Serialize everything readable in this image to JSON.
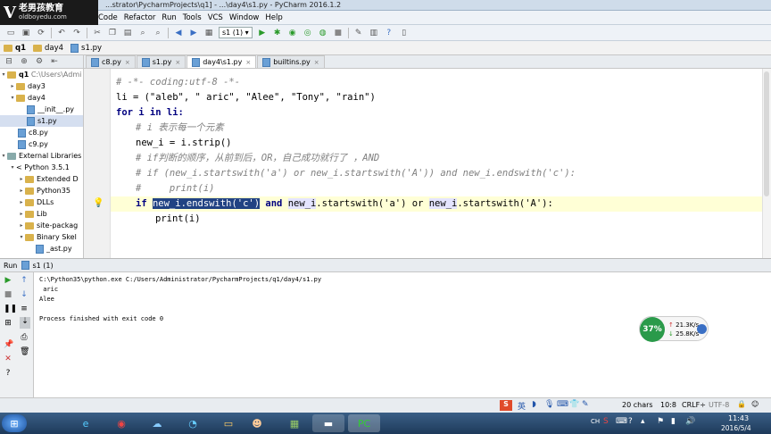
{
  "app": {
    "title": "...strator\\PycharmProjects\\q1] - ...\\day4\\s1.py - PyCharm 2016.1.2",
    "logo_line1": "老男孩教育",
    "logo_line2": "oldboyedu.com"
  },
  "menu": [
    "Code",
    "Refactor",
    "Run",
    "Tools",
    "VCS",
    "Window",
    "Help"
  ],
  "toolbar": {
    "run_config": "s1 (1)"
  },
  "breadcrumb": [
    "q1",
    "day4",
    "s1.py"
  ],
  "tabs": [
    {
      "label": "c8.py"
    },
    {
      "label": "s1.py"
    },
    {
      "label": "day4\\s1.py",
      "active": true
    },
    {
      "label": "builtins.py"
    }
  ],
  "project": {
    "header": "",
    "root": "q1",
    "root_path": "C:\\Users\\Admi",
    "items": [
      {
        "label": "day3",
        "type": "folder",
        "depth": 1
      },
      {
        "label": "day4",
        "type": "folder",
        "depth": 1
      },
      {
        "label": "__init__.py",
        "type": "py",
        "depth": 2
      },
      {
        "label": "s1.py",
        "type": "py",
        "depth": 2,
        "selected": true
      },
      {
        "label": "c8.py",
        "type": "py",
        "depth": 1
      },
      {
        "label": "c9.py",
        "type": "py",
        "depth": 1
      },
      {
        "label": "External Libraries",
        "type": "lib",
        "depth": 0
      },
      {
        "label": "< Python 3.5.1",
        "type": "lib",
        "depth": 1
      },
      {
        "label": "Extended D",
        "type": "folder",
        "depth": 2
      },
      {
        "label": "Python35",
        "type": "folder",
        "depth": 2
      },
      {
        "label": "DLLs",
        "type": "folder",
        "depth": 2
      },
      {
        "label": "Lib",
        "type": "folder",
        "depth": 2
      },
      {
        "label": "site-packag",
        "type": "folder",
        "depth": 2
      },
      {
        "label": "Binary Skel",
        "type": "folder",
        "depth": 2
      },
      {
        "label": "_ast.py",
        "type": "py",
        "depth": 3
      }
    ]
  },
  "code": {
    "line1": "# -*- coding:utf-8 -*-",
    "line2": "li = (\"aleb\", \" aric\", \"Alee\", \"Tony\", \"rain\")",
    "line3": "for i in li:",
    "line4": "# i 表示每一个元素",
    "line5": "new_i = i.strip()",
    "line6": "# if判断的顺序，从前到后，OR，自己成功就行了 ，AND",
    "line7": "# if (new_i.startswith('a') or new_i.startswith('A')) and new_i.endswith('c'):",
    "line8": "#     print(i)",
    "line9a": "if ",
    "line9sel": "new_i.endswith('c')",
    "line9b": " and ",
    "line9c": "new_i",
    "line9d": ".startswith('a') or ",
    "line9e": "new_i",
    "line9f": ".startswith('A'):",
    "line10": "print(i)"
  },
  "run": {
    "tab_label": "Run",
    "config": "s1 (1)",
    "output": [
      "C:\\Python35\\python.exe C:/Users/Administrator/PycharmProjects/q1/day4/s1.py",
      " aric",
      "Alee",
      "",
      "Process finished with exit code 0"
    ]
  },
  "net": {
    "percent": "37%",
    "up": "21.3K/s",
    "down": "25.8K/s"
  },
  "status": {
    "chars": "20 chars",
    "pos": "10:8",
    "crlf": "CRLF÷",
    "enc": "UTF-8"
  },
  "clock": {
    "time": "11:43",
    "date": "2016/5/4",
    "lang": "CH"
  },
  "ime": "英"
}
